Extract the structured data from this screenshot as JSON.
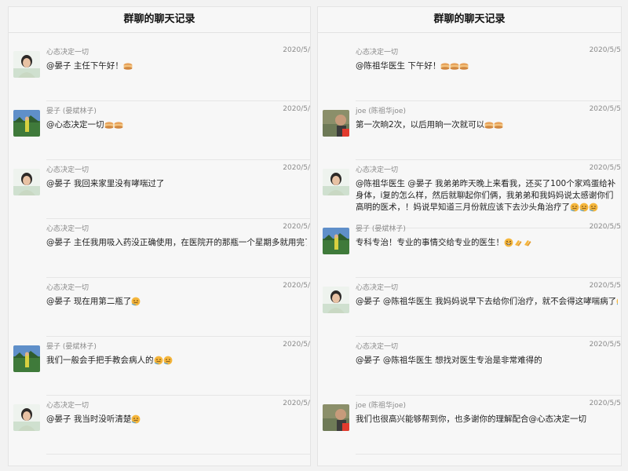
{
  "left_panel": {
    "title": "群聊的聊天记录",
    "messages": [
      {
        "sender": "心态决定一切",
        "date": "2020/5/",
        "text": "@晏子 主任下午好！",
        "emojis": [
          "cake"
        ],
        "avatar": "avatar-woman-icon"
      },
      {
        "sender": "晏子 (晏斌林子)",
        "date": "2020/5/",
        "text": "@心态决定一切",
        "emojis": [
          "cake",
          "cake"
        ],
        "avatar": "avatar-man-landscape-icon"
      },
      {
        "sender": "心态决定一切",
        "date": "2020/5/",
        "text": "@晏子 我回来家里没有哮喘过了",
        "emojis": [],
        "avatar": "avatar-woman-icon"
      },
      {
        "sender": "心态决定一切",
        "date": "2020/5/",
        "text": "@晏子 主任我用吸入药没正确使用，在医院开的那瓶一个星期多就用完了",
        "emojis": [
          "face"
        ],
        "avatar": ""
      },
      {
        "sender": "心态决定一切",
        "date": "2020/5/",
        "text": "@晏子 现在用第二瓶了",
        "emojis": [
          "face"
        ],
        "avatar": ""
      },
      {
        "sender": "晏子 (晏斌林子)",
        "date": "2020/5/",
        "text": "我们一般会手把手教会病人的",
        "emojis": [
          "face",
          "face"
        ],
        "avatar": "avatar-man-landscape-icon"
      },
      {
        "sender": "心态决定一切",
        "date": "2020/5/",
        "text": "@晏子 我当时没听清楚",
        "emojis": [
          "face"
        ],
        "avatar": "avatar-woman-icon"
      }
    ]
  },
  "right_panel": {
    "title": "群聊的聊天记录",
    "messages": [
      {
        "sender": "心态决定一切",
        "date": "2020/5/5",
        "text": "@陈祖华医生 下午好！",
        "emojis": [
          "cake",
          "cake",
          "cake"
        ],
        "avatar": ""
      },
      {
        "sender": "joe (陈祖华joe)",
        "date": "2020/5/5",
        "text": "第一次晌2次，以后用晌一次就可以",
        "emojis": [
          "cake",
          "cake"
        ],
        "avatar": "avatar-doctor-icon"
      },
      {
        "sender": "心态决定一切",
        "date": "2020/5/5",
        "text": "@陈祖华医生 @晏子 我弟弟昨天晚上来看我，还买了100个家鸡蛋给补身体，i复的怎么样，然后就聊起你们俩，我弟弟和我妈妈说太感谢你们高明的医术，！妈说早知道三月份就应该下去沙头角治疗了",
        "emojis": [
          "face",
          "face",
          "face"
        ],
        "avatar": "avatar-woman-icon"
      },
      {
        "sender": "晏子 (晏斌林子)",
        "date": "2020/5/5",
        "text": "专科专治！专业的事情交给专业的医生！",
        "emojis": [
          "grin",
          "clap",
          "clap"
        ],
        "avatar": "avatar-man-landscape-icon"
      },
      {
        "sender": "心态决定一切",
        "date": "2020/5/5",
        "text": "@晏子 @陈祖华医生 我妈妈说早下去给你们治疗，就不会得这哮喘病了",
        "emojis": [
          "face"
        ],
        "avatar": "avatar-woman-icon"
      },
      {
        "sender": "心态决定一切",
        "date": "2020/5/5",
        "text": "@晏子 @陈祖华医生 想找对医生专治是非常难得的",
        "emojis": [],
        "avatar": ""
      },
      {
        "sender": "joe (陈祖华joe)",
        "date": "2020/5/5",
        "text": "我们也很高兴能够帮到你，也多谢你的理解配合@心态决定一切",
        "emojis": [],
        "avatar": "avatar-doctor-icon"
      }
    ]
  },
  "colors": {
    "emoji_yellow": "#f5b63c",
    "emoji_cake": "#e7a25a"
  }
}
